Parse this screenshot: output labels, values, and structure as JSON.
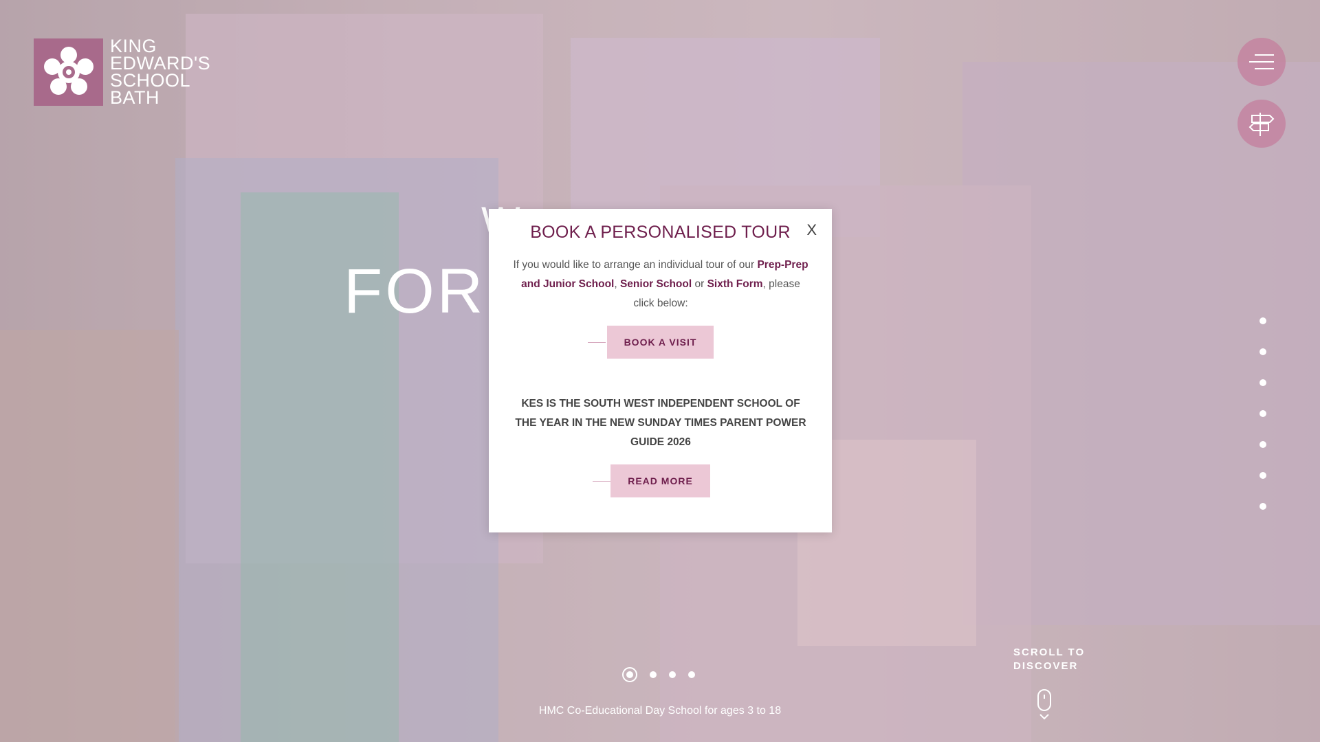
{
  "logo": {
    "lines": [
      "King",
      "Edward's",
      "School",
      "Bath"
    ],
    "brand_color": "#a86a8b"
  },
  "header": {
    "menu_icon": "hamburger-menu-icon",
    "quicklinks_icon": "signpost-icon"
  },
  "hero": {
    "line1": "W",
    "line2": "FOR A         OUS",
    "tagline": "HMC Co-Educational Day School for ages 3 to 18"
  },
  "slider": {
    "dots": 4,
    "active_index": 0
  },
  "side_nav": {
    "dots": 7
  },
  "scroll": {
    "label_line1": "SCROLL TO",
    "label_line2": "DISCOVER",
    "icon": "mouse-scroll-icon"
  },
  "modal": {
    "title": "BOOK A PERSONALISED TOUR",
    "close_label": "X",
    "intro_text": "If you would like to arrange an individual tour of our ",
    "link_prep": "Prep-Prep and Junior School",
    "sep1": ", ",
    "link_senior": "Senior School",
    "sep2": " or ",
    "link_sixth": "Sixth Form",
    "outro_text": ", please click below:",
    "book_button": "BOOK A VISIT",
    "news_text": "KES IS THE SOUTH WEST INDEPENDENT SCHOOL OF THE YEAR IN THE NEW SUNDAY TIMES PARENT POWER GUIDE 2026",
    "read_more_button": "READ MORE",
    "accent_color": "#6e1e4c",
    "button_color": "#ecc8d6"
  }
}
